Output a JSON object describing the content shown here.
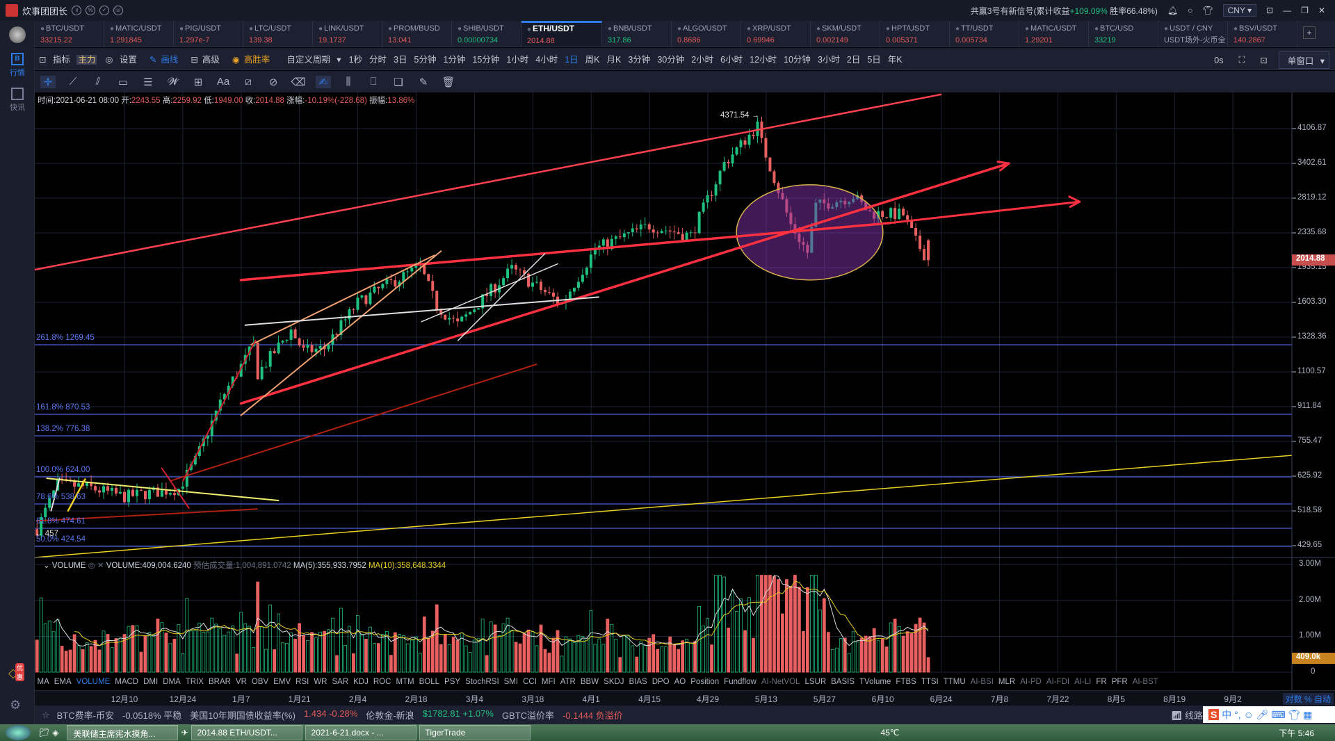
{
  "app": {
    "title": "炊事团团长"
  },
  "header": {
    "signal_prefix": "共赢3号有新信号(累计收益",
    "signal_gain": "+109.09%",
    "signal_suffix": "胜率66.48%)",
    "currency": "CNY"
  },
  "sidebar": [
    {
      "label": "行情",
      "icon": "b-market-icon"
    },
    {
      "label": "快讯",
      "icon": "news-icon"
    }
  ],
  "sidebar_promo": "优惠",
  "tickers": [
    {
      "name": "BTC/USDT",
      "price": "33215.22",
      "dir": "red"
    },
    {
      "name": "MATIC/USDT",
      "price": "1.291845",
      "dir": "red"
    },
    {
      "name": "PIG/USDT",
      "price": "1.297e-7",
      "dir": "red"
    },
    {
      "name": "LTC/USDT",
      "price": "139.38",
      "dir": "red"
    },
    {
      "name": "LINK/USDT",
      "price": "19.1737",
      "dir": "red"
    },
    {
      "name": "PROM/BUSD",
      "price": "13.041",
      "dir": "red"
    },
    {
      "name": "SHIB/USDT",
      "price": "0.00000734",
      "dir": "green"
    },
    {
      "name": "ETH/USDT",
      "price": "2014.88",
      "dir": "red",
      "active": true
    },
    {
      "name": "BNB/USDT",
      "price": "317.86",
      "dir": "green"
    },
    {
      "name": "ALGO/USDT",
      "price": "0.8686",
      "dir": "red"
    },
    {
      "name": "XRP/USDT",
      "price": "0.69946",
      "dir": "red"
    },
    {
      "name": "SKM/USDT",
      "price": "0.002149",
      "dir": "red"
    },
    {
      "name": "HPT/USDT",
      "price": "0.005371",
      "dir": "red"
    },
    {
      "name": "TT/USDT",
      "price": "0.005734",
      "dir": "red"
    },
    {
      "name": "MATIC/USDT",
      "price": "1.29201",
      "dir": "red"
    },
    {
      "name": "BTC/USD",
      "price": "33219",
      "dir": "green"
    },
    {
      "name": "USDT / CNY",
      "price": "USDT场外-火币全",
      "dir": "gray"
    },
    {
      "name": "BSV/USDT",
      "price": "140.2867",
      "dir": "red"
    }
  ],
  "toolbar": {
    "indicator": "指标",
    "main": "主力",
    "settings": "设置",
    "draw": "画线",
    "advanced": "高级",
    "winrate": "高胜率",
    "custom_period": "自定义周期",
    "periods": [
      "1秒",
      "分时",
      "3日",
      "5分钟",
      "1分钟",
      "15分钟",
      "1小时",
      "4小时",
      "1日",
      "周K",
      "月K",
      "3分钟",
      "30分钟",
      "2小时",
      "6小时",
      "12小时",
      "10分钟",
      "3小时",
      "2日",
      "5日",
      "年K"
    ],
    "active_period": "1日",
    "timer": "0s",
    "window": "单窗口"
  },
  "ohlc": {
    "time_label": "时间:",
    "time": "2021-06-21 08:00",
    "open_label": "开:",
    "open": "2243.55",
    "high_label": "高:",
    "high": "2259.92",
    "low_label": "低:",
    "low": "1949.00",
    "close_label": "收:",
    "close": "2014.88",
    "chg_label": "涨幅:",
    "chg": "-10.19%(-228.68)",
    "amp_label": "振幅:",
    "amp": "13.86%"
  },
  "high_marker": "4371.54 →",
  "low_marker": "← 457",
  "fib": [
    "261.8% 1269.45",
    "161.8% 870.53",
    "138.2% 776.38",
    "100.0% 624.00",
    "78.6% 538.63",
    "61.8% 474.61",
    "50.0% 424.54"
  ],
  "fib_prices": [
    1269.45,
    870.53,
    776.38,
    624.0,
    538.63,
    474.61,
    424.54
  ],
  "price_axis": [
    "4106.87",
    "3402.61",
    "2819.12",
    "2335.68",
    "1935.15",
    "1603.30",
    "1328.36",
    "1100.57",
    "911.84",
    "755.47",
    "625.92",
    "518.58",
    "429.65"
  ],
  "last_price": "2014.88",
  "volume": {
    "title": "VOLUME",
    "value": "VOLUME:409,004.6240",
    "est": "预估成交量:1,004,891.0742",
    "ma5": "MA(5):355,933.7952",
    "ma10": "MA(10):358,648.3344",
    "axis": [
      "3.00M",
      "2.00M",
      "1.00M",
      "0"
    ],
    "last": "409.0k"
  },
  "indicators": [
    "MA",
    "EMA",
    "VOLUME",
    "MACD",
    "DMI",
    "DMA",
    "TRIX",
    "BRAR",
    "VR",
    "OBV",
    "EMV",
    "RSI",
    "WR",
    "SAR",
    "KDJ",
    "ROC",
    "MTM",
    "BOLL",
    "PSY",
    "StochRSI",
    "SMI",
    "CCI",
    "MFI",
    "ATR",
    "BBW",
    "SKDJ",
    "BIAS",
    "DPO",
    "AO",
    "Position",
    "Fundflow",
    "AI-NetVOL",
    "LSUR",
    "BASIS",
    "TVolume",
    "FTBS",
    "TTSI",
    "TTMU",
    "AI-BSI",
    "MLR",
    "AI-PD",
    "AI-FDI",
    "AI-LI",
    "FR",
    "PFR",
    "AI-BST"
  ],
  "dim_indicators": [
    "AI-NetVOL",
    "AI-BSI",
    "AI-PD",
    "AI-FDI",
    "AI-LI",
    "AI-BST"
  ],
  "dates": [
    "12月10",
    "12月24",
    "1月7",
    "1月21",
    "2月4",
    "2月18",
    "3月4",
    "3月18",
    "4月1",
    "4月15",
    "4月29",
    "5月13",
    "5月27",
    "6月10",
    "6月24",
    "7月8",
    "7月22",
    "8月5",
    "8月19",
    "9月2"
  ],
  "axis_mode": "对数  %  自动",
  "status": [
    {
      "t": "BTC费率-币安",
      "c": ""
    },
    {
      "t": "-0.0518% 平稳",
      "c": ""
    },
    {
      "t": "美国10年期国债收益率(%)",
      "c": ""
    },
    {
      "t": "1.434  -0.28%",
      "c": "red"
    },
    {
      "t": "伦敦金-新浪",
      "c": ""
    },
    {
      "t": "$1782.81  +1.07%",
      "c": "green"
    },
    {
      "t": "GBTC溢价率",
      "c": ""
    },
    {
      "t": "-0.1444  负溢价",
      "c": "red"
    }
  ],
  "status_right": "线路",
  "taskbar": {
    "tasks": [
      "美联储主席宪水摸角...",
      "2014.88 ETH/USDT...",
      "2021-6-21.docx - ...",
      "TigerTrade"
    ],
    "temp": "45℃",
    "clock": "下午 5:46"
  },
  "colors": {
    "up": "#1fbf7f",
    "down": "#e86060",
    "fib": "#4a60e0",
    "accent": "#2f7ce8"
  },
  "price_anchors": [
    [
      0,
      470
    ],
    [
      5,
      600
    ],
    [
      12,
      590
    ],
    [
      21,
      560
    ],
    [
      34,
      585
    ],
    [
      38,
      680
    ],
    [
      45,
      980
    ],
    [
      52,
      1270
    ],
    [
      53,
      1090
    ],
    [
      61,
      1380
    ],
    [
      64,
      1230
    ],
    [
      69,
      1250
    ],
    [
      77,
      1600
    ],
    [
      83,
      1740
    ],
    [
      92,
      1940
    ],
    [
      96,
      1570
    ],
    [
      101,
      1420
    ],
    [
      114,
      1920
    ],
    [
      126,
      1590
    ],
    [
      134,
      2140
    ],
    [
      147,
      2430
    ],
    [
      157,
      2300
    ],
    [
      165,
      3400
    ],
    [
      173,
      4170
    ],
    [
      174,
      3800
    ],
    [
      181,
      2440
    ],
    [
      185,
      2100
    ],
    [
      187,
      2700
    ],
    [
      196,
      2850
    ],
    [
      200,
      2600
    ],
    [
      208,
      2580
    ],
    [
      211,
      2230
    ],
    [
      214,
      2014.88
    ]
  ]
}
